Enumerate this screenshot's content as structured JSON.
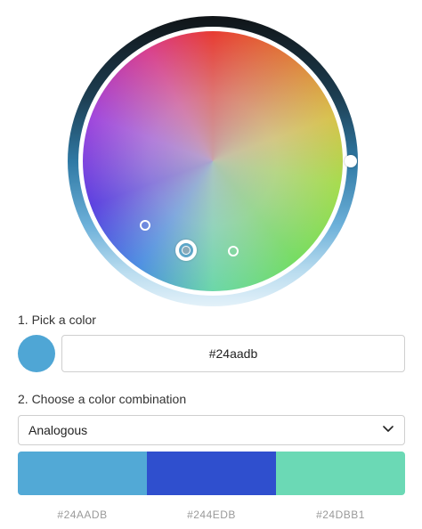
{
  "picker": {
    "step1_label": "1. Pick a color",
    "selected_hex": "#24aadb",
    "swatch_color": "#4fa6d5"
  },
  "combination": {
    "step2_label": "2. Choose a color combination",
    "selected_option": "Analogous"
  },
  "palette": {
    "swatches": [
      {
        "code": "#24AADB",
        "display_color": "#52a9d6"
      },
      {
        "code": "#244EDB",
        "display_color": "#2f4fce"
      },
      {
        "code": "#24DBB1",
        "display_color": "#6bd9b5"
      }
    ]
  },
  "icons": {
    "dropdown": "chevron-down-icon"
  }
}
